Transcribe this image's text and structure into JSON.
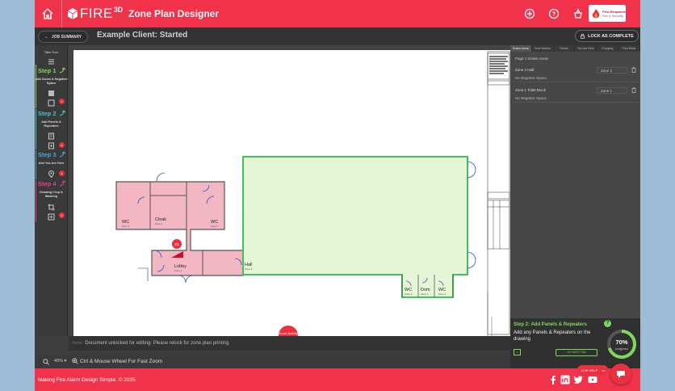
{
  "header": {
    "logo_text": "FIRE",
    "logo_sup": "3D",
    "title": "Zone Plan Designer",
    "brand_text_1": "First Response",
    "brand_text_2": "Fire & Security"
  },
  "subheader": {
    "job_summary_label": "JOB SUMMARY",
    "client_title": "Example Client: Started",
    "lock_label": "LOCK AS COMPLETE"
  },
  "sidebar": {
    "take_tour": "Take Tour",
    "steps": [
      {
        "title": "Step 1",
        "desc": "Add Zones & Negative Space",
        "color": "#7fd85c"
      },
      {
        "title": "Step 2",
        "desc": "Add Panels & Repeaters",
        "color": "#3ec7c7"
      },
      {
        "title": "Step 3",
        "desc": "Add You Are Here",
        "color": "#4aa3e0"
      },
      {
        "title": "Step 4",
        "desc": "Drawing Crop & Masking",
        "color": "#e0409a"
      }
    ],
    "badge": "x"
  },
  "plan": {
    "rooms": [
      {
        "label": "WC",
        "sub": "Zone 1"
      },
      {
        "label": "Cloak",
        "sub": "Zone 1"
      },
      {
        "label": "WC",
        "sub": "Zone 1"
      },
      {
        "label": "Lobby",
        "sub": "Zone 1"
      },
      {
        "label": "Hall",
        "sub": "Zone 2"
      },
      {
        "label": "WC",
        "sub": "Zone 2"
      },
      {
        "label": "Dom",
        "sub": "Zone 2"
      },
      {
        "label": "WC",
        "sub": "Zone 2"
      }
    ],
    "panel_label": "Z1",
    "pink": "#f3b7c4",
    "green": "#e6f5d5",
    "green_border": "#3ec35c"
  },
  "status": {
    "prefix": "Home",
    "message": "Document unlocked for editing: Please relock for zone plan printing",
    "zoom_badge": "Zoom Activity"
  },
  "right_panel": {
    "tabs": [
      "Drawn Areas",
      "Zone Names",
      "Panels",
      "You Are Here",
      "Cropping",
      "Print Mode"
    ],
    "page_label": "Page 1 Drawn Areas",
    "zones": [
      {
        "name": "Zone 2 Hall",
        "select": "Zone 2",
        "neg": "No Negative Space"
      },
      {
        "name": "Zone 1 Toilet Block",
        "select": "Zone 1",
        "neg": "No Negative Space"
      }
    ]
  },
  "help": {
    "title": "Step 2: Add Panels & Repeaters",
    "body": "Add any Panels & Repeaters on the drawing",
    "q": "?",
    "progress_value": "70%",
    "progress_label": "progress",
    "progress_fraction": 0.7,
    "next_label": "GO NEXT TAB",
    "small_btn": "‹‹"
  },
  "zoombar": {
    "level": "40%",
    "tip": "Ctrl & Mouse Wheel For Fast Zoom"
  },
  "footer": {
    "text": "Making Fire Alarm Design Simple. © 2025",
    "chat_pill": "LIVE HELP"
  },
  "colors": {
    "brand_red": "#f0324b",
    "accent_green": "#7fd85c"
  }
}
